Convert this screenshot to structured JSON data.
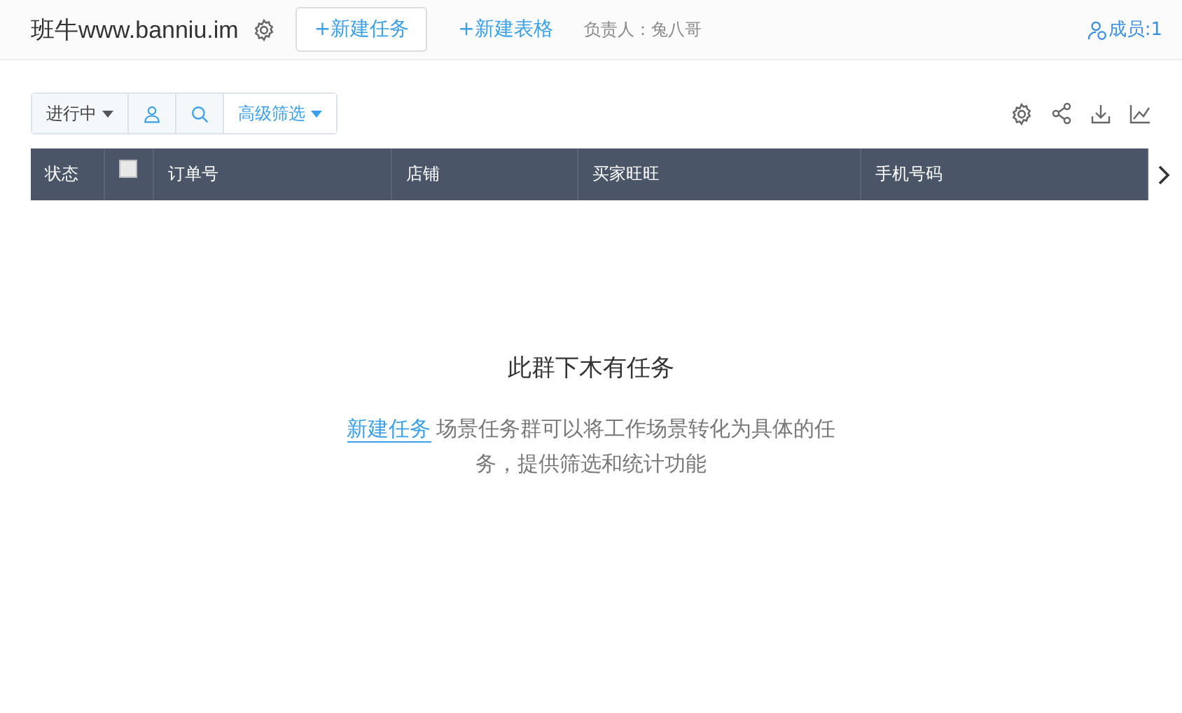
{
  "header": {
    "title": "班牛www.banniu.im",
    "new_task_button": "+新建任务",
    "new_table_link": "+新建表格",
    "owner": "负责人：兔八哥",
    "members": "成员:1"
  },
  "filters": {
    "status": "进行中",
    "advanced": "高级筛选"
  },
  "table": {
    "columns": [
      {
        "kind": "text",
        "label": "状态"
      },
      {
        "kind": "checkbox",
        "checked": false
      },
      {
        "kind": "text",
        "label": "订单号"
      },
      {
        "kind": "text",
        "label": "店铺"
      },
      {
        "kind": "text",
        "label": "买家旺旺"
      },
      {
        "kind": "text",
        "label": "手机号码"
      }
    ]
  },
  "empty": {
    "title": "此群下木有任务",
    "link": "新建任务",
    "text": "场景任务群可以将工作场景转化为具体的任务，提供筛选和统计功能"
  }
}
